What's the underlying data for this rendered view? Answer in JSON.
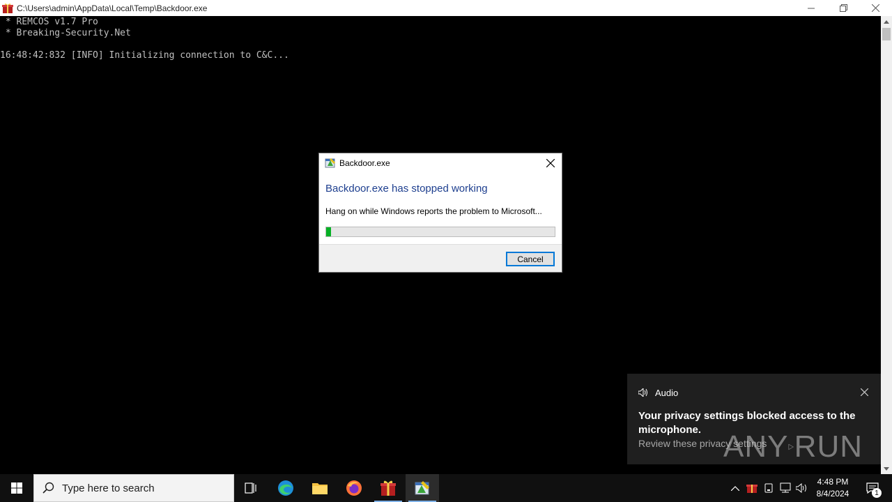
{
  "window": {
    "title": "C:\\Users\\admin\\AppData\\Local\\Temp\\Backdoor.exe"
  },
  "console": {
    "lines": [
      " * REMCOS v1.7 Pro",
      " * Breaking-Security.Net",
      "",
      "16:48:42:832 [INFO] Initializing connection to C&C..."
    ]
  },
  "dialog": {
    "title": "Backdoor.exe",
    "heading": "Backdoor.exe has stopped working",
    "message": "Hang on while Windows reports the problem to Microsoft...",
    "progress_fraction": 0.02,
    "cancel_label": "Cancel"
  },
  "toast": {
    "app_name": "Audio",
    "headline": "Your privacy settings blocked access to the microphone.",
    "link": "Review these privacy settings"
  },
  "watermark": {
    "left": "ANY",
    "right": "RUN"
  },
  "taskbar": {
    "search_placeholder": "Type here to search",
    "time": "4:48 PM",
    "date": "8/4/2024",
    "notification_count": "1"
  },
  "colors": {
    "dialog_heading": "#1e3f8f",
    "progress_fill": "#06b025",
    "accent": "#0078d7"
  }
}
